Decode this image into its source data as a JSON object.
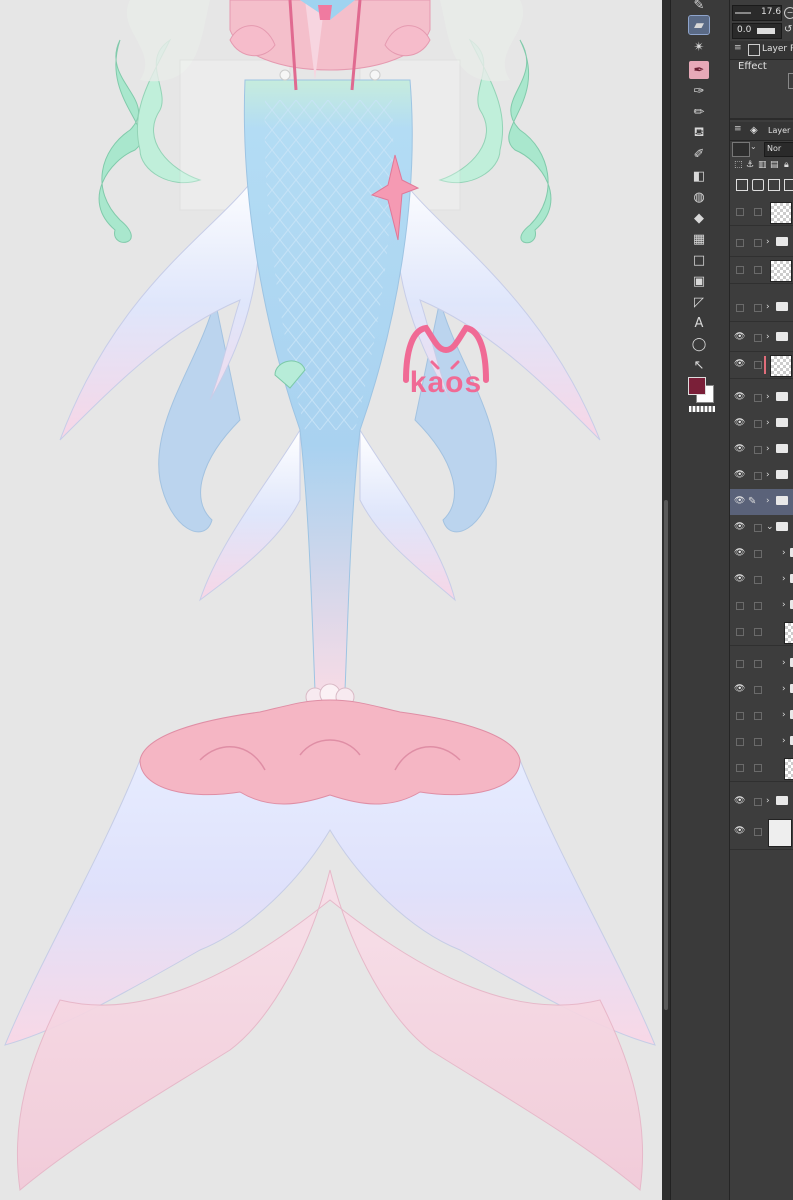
{
  "toolbar_top": {
    "brush_size": "17.6",
    "opacity": "0.0"
  },
  "panels": {
    "layer_property_tab": "Layer P",
    "effect_label": "Effect",
    "layer_tab": "Layer",
    "blend_mode": "Nor"
  },
  "watermark": {
    "text": "kaos",
    "color": "#f06a95"
  },
  "colors": {
    "main_color": "#7a1f38",
    "sub_color": "#ffffff",
    "tail_blue": "#a9d2f0",
    "tail_pink": "#f5b6c4",
    "hair_mint": "#a6e8cc"
  },
  "tools": [
    {
      "name": "operation-icon"
    },
    {
      "name": "eraser-icon"
    },
    {
      "name": "auto-select-icon"
    },
    {
      "name": "pen-icon"
    },
    {
      "name": "marker-icon"
    },
    {
      "name": "pencil-icon"
    },
    {
      "name": "airbrush-icon"
    },
    {
      "name": "decoration-icon"
    },
    {
      "name": "eraser-2-icon"
    },
    {
      "name": "blend-icon"
    },
    {
      "name": "fill-icon"
    },
    {
      "name": "gradient-icon"
    },
    {
      "name": "figure-icon"
    },
    {
      "name": "frame-icon"
    },
    {
      "name": "ruler-icon"
    },
    {
      "name": "text-icon"
    },
    {
      "name": "balloon-icon"
    },
    {
      "name": "correct-line-icon"
    }
  ]
}
